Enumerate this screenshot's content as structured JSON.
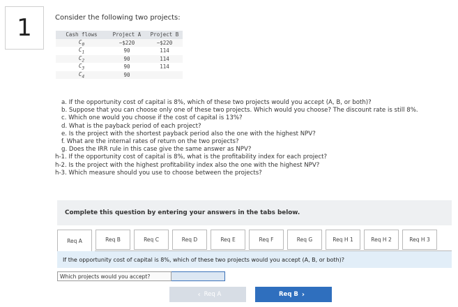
{
  "question_number": "1",
  "intro": "Consider the following two projects:",
  "table": {
    "headers": [
      "Cash flows",
      "Project A",
      "Project B"
    ],
    "rows": [
      {
        "label_base": "C",
        "label_sub": "0",
        "a": "−$220",
        "b": "−$220"
      },
      {
        "label_base": "C",
        "label_sub": "1",
        "a": "90",
        "b": "114"
      },
      {
        "label_base": "C",
        "label_sub": "2",
        "a": "90",
        "b": "114"
      },
      {
        "label_base": "C",
        "label_sub": "3",
        "a": "90",
        "b": "114"
      },
      {
        "label_base": "C",
        "label_sub": "4",
        "a": "90",
        "b": ""
      }
    ]
  },
  "questions": [
    "a. If the opportunity cost of capital is 8%, which of these two projects would you accept (A, B, or both)?",
    "b. Suppose that you can choose only one of these two projects. Which would you choose? The discount rate is still 8%.",
    "c. Which one would you choose if the cost of capital is 13%?",
    "d. What is the payback period of each project?",
    "e. Is the project with the shortest payback period also the one with the highest NPV?",
    "f. What are the internal rates of return on the two projects?",
    "g. Does the IRR rule in this case give the same answer as NPV?",
    "h-1. If the opportunity cost of capital is 8%, what is the profitability index for each project?",
    "h-2. Is the project with the highest profitability index also the one with the highest NPV?",
    "h-3. Which measure should you use to choose between the projects?"
  ],
  "banner": "Complete this question by entering your answers in the tabs below.",
  "tabs": [
    "Req A",
    "Req B",
    "Req C",
    "Req D",
    "Req E",
    "Req F",
    "Req G",
    "Req H 1",
    "Req H 2",
    "Req H 3"
  ],
  "active_tab": "Req A",
  "prompt": "If the opportunity cost of capital is 8%, which of these two projects would you accept (A, B, or both)?",
  "answer": {
    "label": "Which projects would you accept?",
    "value": ""
  },
  "nav": {
    "prev": "Req A",
    "next": "Req B"
  },
  "colors": {
    "accent": "#2f6fbe",
    "panel": "#e2eef8",
    "banner": "#eef0f2",
    "disabled": "#d7dde5"
  }
}
